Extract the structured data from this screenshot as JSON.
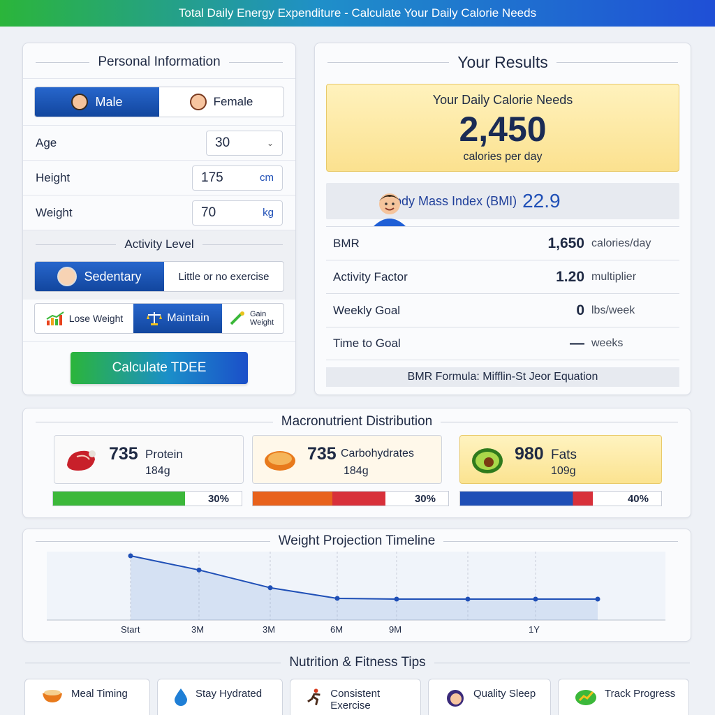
{
  "header": {
    "title": "Total Daily Energy Expenditure - Calculate Your Daily Calorie Needs"
  },
  "personal": {
    "title": "Personal Information",
    "gender": {
      "male": "Male",
      "female": "Female",
      "selected": "Male"
    },
    "age": {
      "label": "Age",
      "value": "30"
    },
    "height": {
      "label": "Height",
      "value": "175",
      "unit": "cm"
    },
    "weight": {
      "label": "Weight",
      "value": "70",
      "unit": "kg"
    },
    "activity": {
      "title": "Activity Level",
      "selected": "Sedentary",
      "description": "Little or no exercise"
    },
    "goals": {
      "lose": "Lose Weight",
      "maintain": "Maintain",
      "gain": "Gain Weight",
      "selected": "Maintain"
    },
    "calculate": "Calculate TDEE"
  },
  "results": {
    "title": "Your Results",
    "calorie_label": "Your Daily Calorie Needs",
    "calories": "2,450",
    "calorie_unit": "calories per day",
    "bmi_label": "Body Mass Index (BMI)",
    "bmi_value": "22.9",
    "rows": [
      {
        "label": "BMR",
        "value": "1,650",
        "suffix": "calories/day"
      },
      {
        "label": "Activity Factor",
        "value": "1.20",
        "suffix": "multiplier"
      },
      {
        "label": "Weekly Goal",
        "value": "0",
        "suffix": "lbs/week"
      },
      {
        "label": "Time to Goal",
        "value": "—",
        "suffix": "weeks"
      }
    ],
    "formula": "BMR Formula: Mifflin-St Jeor Equation"
  },
  "macros": {
    "title": "Macronutrient Distribution",
    "items": [
      {
        "cal": "735",
        "name": "Protein",
        "grams": "184g",
        "pct": "30%",
        "fraction": 0.3
      },
      {
        "cal": "735",
        "name": "Carbohydrates",
        "grams": "184g",
        "pct": "30%",
        "fraction": 0.3
      },
      {
        "cal": "980",
        "name": "Fats",
        "grams": "109g",
        "pct": "40%",
        "fraction": 0.4
      }
    ]
  },
  "timeline": {
    "title": "Weight Projection Timeline",
    "x_labels": [
      "Start",
      "3M",
      "3M",
      "6M",
      "9M",
      "1Y"
    ]
  },
  "tips": {
    "title": "Nutrition & Fitness Tips",
    "items": [
      "Meal Timing",
      "Stay Hydrated",
      "Consistent Exercise",
      "Quality Sleep",
      "Track Progress"
    ]
  },
  "colors": {
    "accent": "#1f4fd6",
    "green": "#2bb53a",
    "protein": "#3cb83a",
    "carb": "#e85a1c",
    "fat": "#1f4fb6"
  },
  "chart_data": {
    "type": "line",
    "title": "Weight Projection Timeline",
    "x": [
      "Start",
      "",
      "3M",
      "",
      "6M",
      "9M",
      "",
      "1Y",
      ""
    ],
    "series": [
      {
        "values": [
          70,
          69.2,
          68.2,
          67.6,
          67.0,
          67.0,
          67.2,
          67.0,
          66.6
        ]
      }
    ],
    "grid": true
  }
}
